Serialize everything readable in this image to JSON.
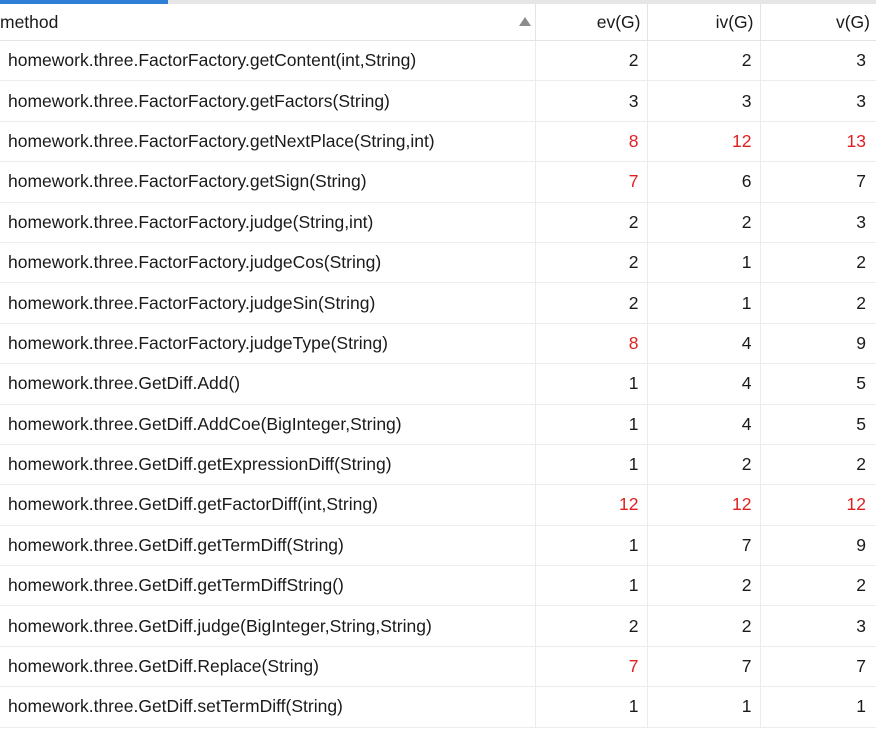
{
  "table": {
    "columns": [
      {
        "label": "method",
        "sort": "ascending",
        "sort_icon": "sort-up-triangle-icon"
      },
      {
        "label": "ev(G)"
      },
      {
        "label": "iv(G)"
      },
      {
        "label": "v(G)"
      }
    ],
    "highlight_color": "#e02020",
    "rows": [
      {
        "method": "homework.three.FactorFactory.getContent(int,String)",
        "ev": "2",
        "iv": "2",
        "v": "3",
        "red": [
          false,
          false,
          false
        ]
      },
      {
        "method": "homework.three.FactorFactory.getFactors(String)",
        "ev": "3",
        "iv": "3",
        "v": "3",
        "red": [
          false,
          false,
          false
        ]
      },
      {
        "method": "homework.three.FactorFactory.getNextPlace(String,int)",
        "ev": "8",
        "iv": "12",
        "v": "13",
        "red": [
          true,
          true,
          true
        ]
      },
      {
        "method": "homework.three.FactorFactory.getSign(String)",
        "ev": "7",
        "iv": "6",
        "v": "7",
        "red": [
          true,
          false,
          false
        ]
      },
      {
        "method": "homework.three.FactorFactory.judge(String,int)",
        "ev": "2",
        "iv": "2",
        "v": "3",
        "red": [
          false,
          false,
          false
        ]
      },
      {
        "method": "homework.three.FactorFactory.judgeCos(String)",
        "ev": "2",
        "iv": "1",
        "v": "2",
        "red": [
          false,
          false,
          false
        ]
      },
      {
        "method": "homework.three.FactorFactory.judgeSin(String)",
        "ev": "2",
        "iv": "1",
        "v": "2",
        "red": [
          false,
          false,
          false
        ]
      },
      {
        "method": "homework.three.FactorFactory.judgeType(String)",
        "ev": "8",
        "iv": "4",
        "v": "9",
        "red": [
          true,
          false,
          false
        ]
      },
      {
        "method": "homework.three.GetDiff.Add()",
        "ev": "1",
        "iv": "4",
        "v": "5",
        "red": [
          false,
          false,
          false
        ]
      },
      {
        "method": "homework.three.GetDiff.AddCoe(BigInteger,String)",
        "ev": "1",
        "iv": "4",
        "v": "5",
        "red": [
          false,
          false,
          false
        ]
      },
      {
        "method": "homework.three.GetDiff.getExpressionDiff(String)",
        "ev": "1",
        "iv": "2",
        "v": "2",
        "red": [
          false,
          false,
          false
        ]
      },
      {
        "method": "homework.three.GetDiff.getFactorDiff(int,String)",
        "ev": "12",
        "iv": "12",
        "v": "12",
        "red": [
          true,
          true,
          true
        ]
      },
      {
        "method": "homework.three.GetDiff.getTermDiff(String)",
        "ev": "1",
        "iv": "7",
        "v": "9",
        "red": [
          false,
          false,
          false
        ]
      },
      {
        "method": "homework.three.GetDiff.getTermDiffString()",
        "ev": "1",
        "iv": "2",
        "v": "2",
        "red": [
          false,
          false,
          false
        ]
      },
      {
        "method": "homework.three.GetDiff.judge(BigInteger,String,String)",
        "ev": "2",
        "iv": "2",
        "v": "3",
        "red": [
          false,
          false,
          false
        ]
      },
      {
        "method": "homework.three.GetDiff.Replace(String)",
        "ev": "7",
        "iv": "7",
        "v": "7",
        "red": [
          true,
          false,
          false
        ]
      },
      {
        "method": "homework.three.GetDiff.setTermDiff(String)",
        "ev": "1",
        "iv": "1",
        "v": "1",
        "red": [
          false,
          false,
          false
        ]
      }
    ]
  }
}
